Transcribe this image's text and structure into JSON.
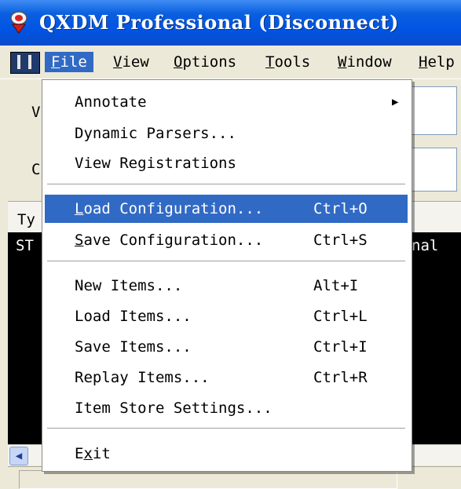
{
  "window": {
    "title": "QXDM Professional (Disconnect)"
  },
  "menubar": [
    {
      "label": "File",
      "mnemonic": "F",
      "rest": "ile",
      "active": true
    },
    {
      "label": "View",
      "mnemonic": "V",
      "rest": "iew"
    },
    {
      "label": "Options",
      "mnemonic": "O",
      "rest": "ptions"
    },
    {
      "label": "Tools",
      "mnemonic": "T",
      "rest": "ools"
    },
    {
      "label": "Window",
      "mnemonic": "W",
      "rest": "indow"
    },
    {
      "label": "Help",
      "mnemonic": "H",
      "rest": "elp"
    }
  ],
  "background": {
    "panel1_text": "V",
    "panel2_text": "C",
    "header_text": "Ty",
    "console_left": "ST",
    "console_right": "nal"
  },
  "file_menu": {
    "annotate": {
      "label": "Annotate",
      "has_submenu": true
    },
    "dynamic_parsers": {
      "label": "Dynamic Parsers..."
    },
    "view_registrations": {
      "label": "View Registrations"
    },
    "load_configuration": {
      "mnemonic": "L",
      "rest": "oad Configuration...",
      "shortcut": "Ctrl+O",
      "highlighted": true
    },
    "save_configuration": {
      "mnemonic": "S",
      "rest": "ave Configuration...",
      "shortcut": "Ctrl+S"
    },
    "new_items": {
      "label": "New Items...",
      "shortcut": "Alt+I"
    },
    "load_items": {
      "label": "Load Items...",
      "shortcut": "Ctrl+L"
    },
    "save_items": {
      "label": "Save Items...",
      "shortcut": "Ctrl+I"
    },
    "replay_items": {
      "label": "Replay Items...",
      "shortcut": "Ctrl+R"
    },
    "item_store_settings": {
      "label": "Item Store Settings..."
    },
    "exit": {
      "pre": "E",
      "mnemonic": "x",
      "rest": "it"
    }
  },
  "colors": {
    "highlight": "#316ac5",
    "titlebar": "#0054e3"
  }
}
